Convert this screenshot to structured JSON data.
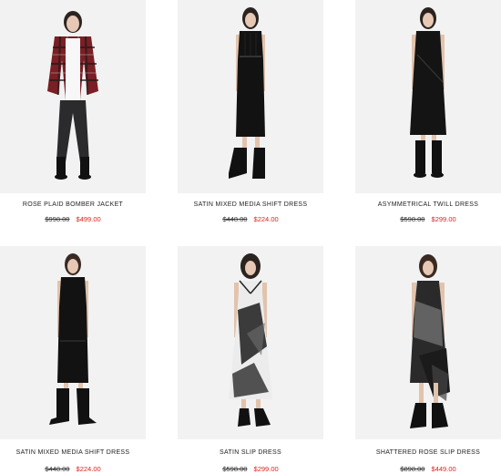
{
  "colors": {
    "sale": "#e02020",
    "original": "#333333",
    "photo_bg": "#f2f2f2"
  },
  "products": [
    {
      "name": "ROSE PLAID BOMBER JACKET",
      "original_price": "$998.00",
      "sale_price": "$499.00",
      "image": "model-plaid-jacket-image"
    },
    {
      "name": "SATIN MIXED MEDIA SHIFT DRESS",
      "original_price": "$448.00",
      "sale_price": "$224.00",
      "image": "model-black-shift-dress-image"
    },
    {
      "name": "ASYMMETRICAL TWILL DRESS",
      "original_price": "$598.00",
      "sale_price": "$299.00",
      "image": "model-black-twill-dress-image"
    },
    {
      "name": "SATIN MIXED MEDIA SHIFT DRESS",
      "original_price": "$448.00",
      "sale_price": "$224.00",
      "image": "model-black-shift-dress-image"
    },
    {
      "name": "SATIN SLIP DRESS",
      "original_price": "$598.00",
      "sale_price": "$299.00",
      "image": "model-print-slip-dress-image"
    },
    {
      "name": "SHATTERED ROSE SLIP DRESS",
      "original_price": "$898.00",
      "sale_price": "$449.00",
      "image": "model-lace-slip-dress-image"
    }
  ]
}
